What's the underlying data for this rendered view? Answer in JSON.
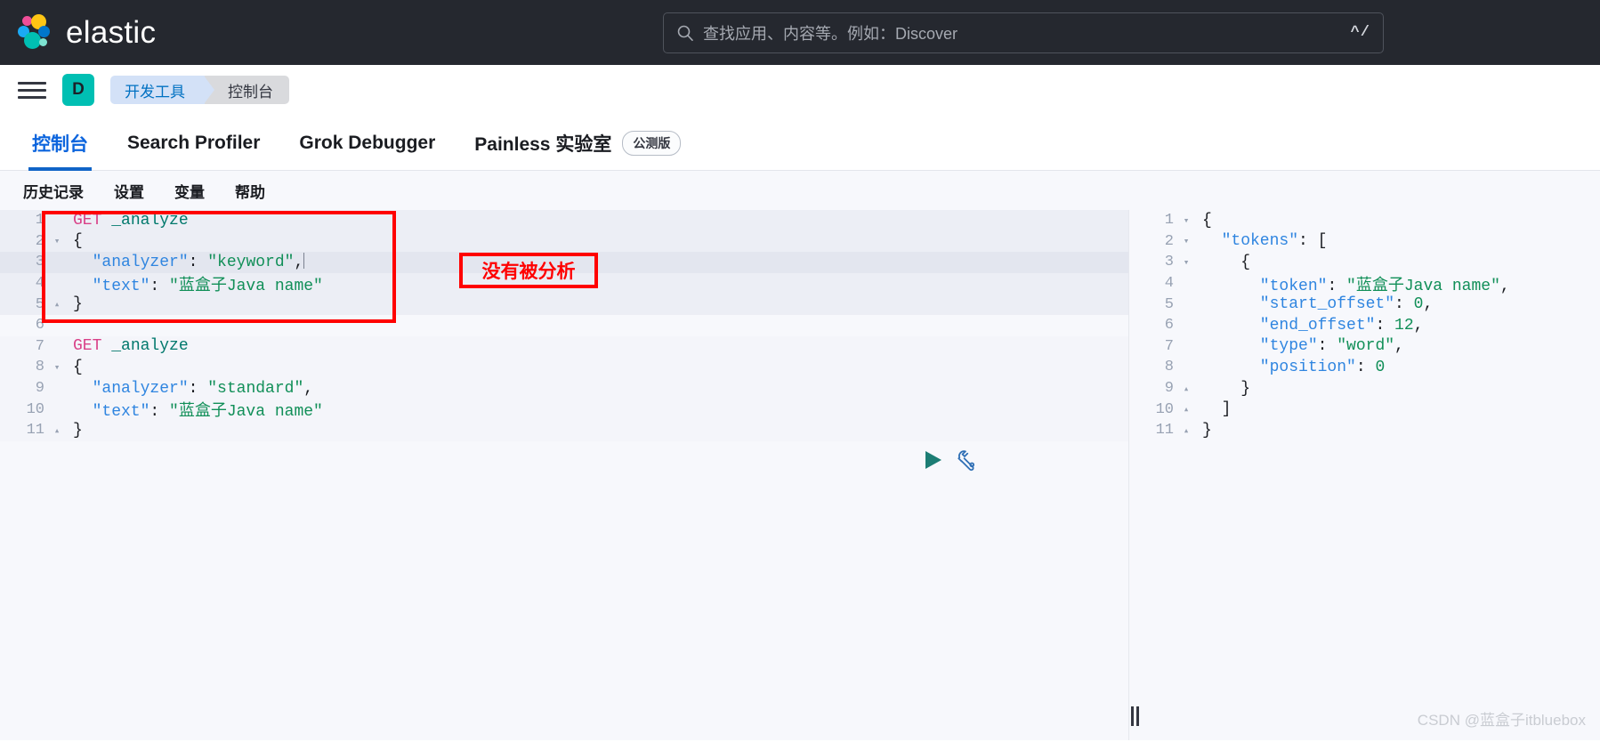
{
  "header": {
    "brand_name": "elastic",
    "logo_icon": "elastic-logo-icon",
    "search": {
      "icon": "search-icon",
      "placeholder": "查找应用、内容等。例如：Discover",
      "shortcut": "^/"
    }
  },
  "breadcrumb_bar": {
    "menu_icon": "hamburger-menu-icon",
    "space_avatar": "D",
    "crumbs": [
      {
        "label": "开发工具"
      },
      {
        "label": "控制台"
      }
    ]
  },
  "tabs": [
    {
      "label": "控制台",
      "active": true,
      "badge": ""
    },
    {
      "label": "Search Profiler",
      "active": false,
      "badge": ""
    },
    {
      "label": "Grok Debugger",
      "active": false,
      "badge": ""
    },
    {
      "label": "Painless 实验室",
      "active": false,
      "badge": "公测版"
    }
  ],
  "submenu": [
    {
      "label": "历史记录"
    },
    {
      "label": "设置"
    },
    {
      "label": "变量"
    },
    {
      "label": "帮助"
    }
  ],
  "editor": {
    "run_button_icon": "play-icon",
    "wrench_button_icon": "wrench-icon",
    "lines": [
      {
        "num": "1",
        "fold": "",
        "indent": 0,
        "tokens": [
          {
            "t": "method",
            "v": "GET"
          },
          {
            "t": "sp",
            "v": " "
          },
          {
            "t": "url",
            "v": "_analyze"
          }
        ]
      },
      {
        "num": "2",
        "fold": "▾",
        "indent": 0,
        "tokens": [
          {
            "t": "punct",
            "v": "{"
          }
        ]
      },
      {
        "num": "3",
        "fold": "",
        "indent": 0,
        "highlight": true,
        "tokens": [
          {
            "t": "key",
            "v": "  \"analyzer\""
          },
          {
            "t": "punct",
            "v": ": "
          },
          {
            "t": "str",
            "v": "\"keyword\""
          },
          {
            "t": "punct",
            "v": ","
          },
          {
            "t": "cursor",
            "v": ""
          }
        ]
      },
      {
        "num": "4",
        "fold": "",
        "indent": 0,
        "tokens": [
          {
            "t": "key",
            "v": "  \"text\""
          },
          {
            "t": "punct",
            "v": ": "
          },
          {
            "t": "str",
            "v": "\"蓝盒子Java name\""
          }
        ]
      },
      {
        "num": "5",
        "fold": "▴",
        "indent": 0,
        "tokens": [
          {
            "t": "punct",
            "v": "}"
          }
        ]
      },
      {
        "num": "6",
        "fold": "",
        "indent": 0,
        "tokens": []
      },
      {
        "num": "7",
        "fold": "",
        "indent": 0,
        "tokens": [
          {
            "t": "method",
            "v": "GET"
          },
          {
            "t": "sp",
            "v": " "
          },
          {
            "t": "url",
            "v": "_analyze"
          }
        ]
      },
      {
        "num": "8",
        "fold": "▾",
        "indent": 0,
        "tokens": [
          {
            "t": "punct",
            "v": "{"
          }
        ]
      },
      {
        "num": "9",
        "fold": "",
        "indent": 0,
        "tokens": [
          {
            "t": "key",
            "v": "  \"analyzer\""
          },
          {
            "t": "punct",
            "v": ": "
          },
          {
            "t": "str",
            "v": "\"standard\""
          },
          {
            "t": "punct",
            "v": ","
          }
        ]
      },
      {
        "num": "10",
        "fold": "",
        "indent": 0,
        "tokens": [
          {
            "t": "key",
            "v": "  \"text\""
          },
          {
            "t": "punct",
            "v": ": "
          },
          {
            "t": "str",
            "v": "\"蓝盒子Java name\""
          }
        ]
      },
      {
        "num": "11",
        "fold": "▴",
        "indent": 0,
        "tokens": [
          {
            "t": "punct",
            "v": "}"
          }
        ]
      }
    ]
  },
  "annotations": [
    {
      "label": "没有被分析",
      "color": "#ff0000"
    }
  ],
  "response": {
    "lines": [
      {
        "num": "1",
        "fold": "▾",
        "tokens": [
          {
            "t": "punct",
            "v": "{"
          }
        ]
      },
      {
        "num": "2",
        "fold": "▾",
        "tokens": [
          {
            "t": "key",
            "v": "  \"tokens\""
          },
          {
            "t": "punct",
            "v": ": ["
          }
        ]
      },
      {
        "num": "3",
        "fold": "▾",
        "tokens": [
          {
            "t": "punct",
            "v": "    {"
          }
        ]
      },
      {
        "num": "4",
        "fold": "",
        "tokens": [
          {
            "t": "key",
            "v": "      \"token\""
          },
          {
            "t": "punct",
            "v": ": "
          },
          {
            "t": "str",
            "v": "\"蓝盒子Java name\""
          },
          {
            "t": "punct",
            "v": ","
          }
        ]
      },
      {
        "num": "5",
        "fold": "",
        "tokens": [
          {
            "t": "key",
            "v": "      \"start_offset\""
          },
          {
            "t": "punct",
            "v": ": "
          },
          {
            "t": "num",
            "v": "0"
          },
          {
            "t": "punct",
            "v": ","
          }
        ]
      },
      {
        "num": "6",
        "fold": "",
        "tokens": [
          {
            "t": "key",
            "v": "      \"end_offset\""
          },
          {
            "t": "punct",
            "v": ": "
          },
          {
            "t": "num",
            "v": "12"
          },
          {
            "t": "punct",
            "v": ","
          }
        ]
      },
      {
        "num": "7",
        "fold": "",
        "tokens": [
          {
            "t": "key",
            "v": "      \"type\""
          },
          {
            "t": "punct",
            "v": ": "
          },
          {
            "t": "str",
            "v": "\"word\""
          },
          {
            "t": "punct",
            "v": ","
          }
        ]
      },
      {
        "num": "8",
        "fold": "",
        "tokens": [
          {
            "t": "key",
            "v": "      \"position\""
          },
          {
            "t": "punct",
            "v": ": "
          },
          {
            "t": "num",
            "v": "0"
          }
        ]
      },
      {
        "num": "9",
        "fold": "▴",
        "tokens": [
          {
            "t": "punct",
            "v": "    }"
          }
        ]
      },
      {
        "num": "10",
        "fold": "▴",
        "tokens": [
          {
            "t": "punct",
            "v": "  ]"
          }
        ]
      },
      {
        "num": "11",
        "fold": "▴",
        "tokens": [
          {
            "t": "punct",
            "v": "}"
          }
        ]
      }
    ]
  },
  "footer": {
    "watermark": "CSDN @蓝盒子itbluebox",
    "split_handle_icon": "split-resize-handle-icon"
  }
}
